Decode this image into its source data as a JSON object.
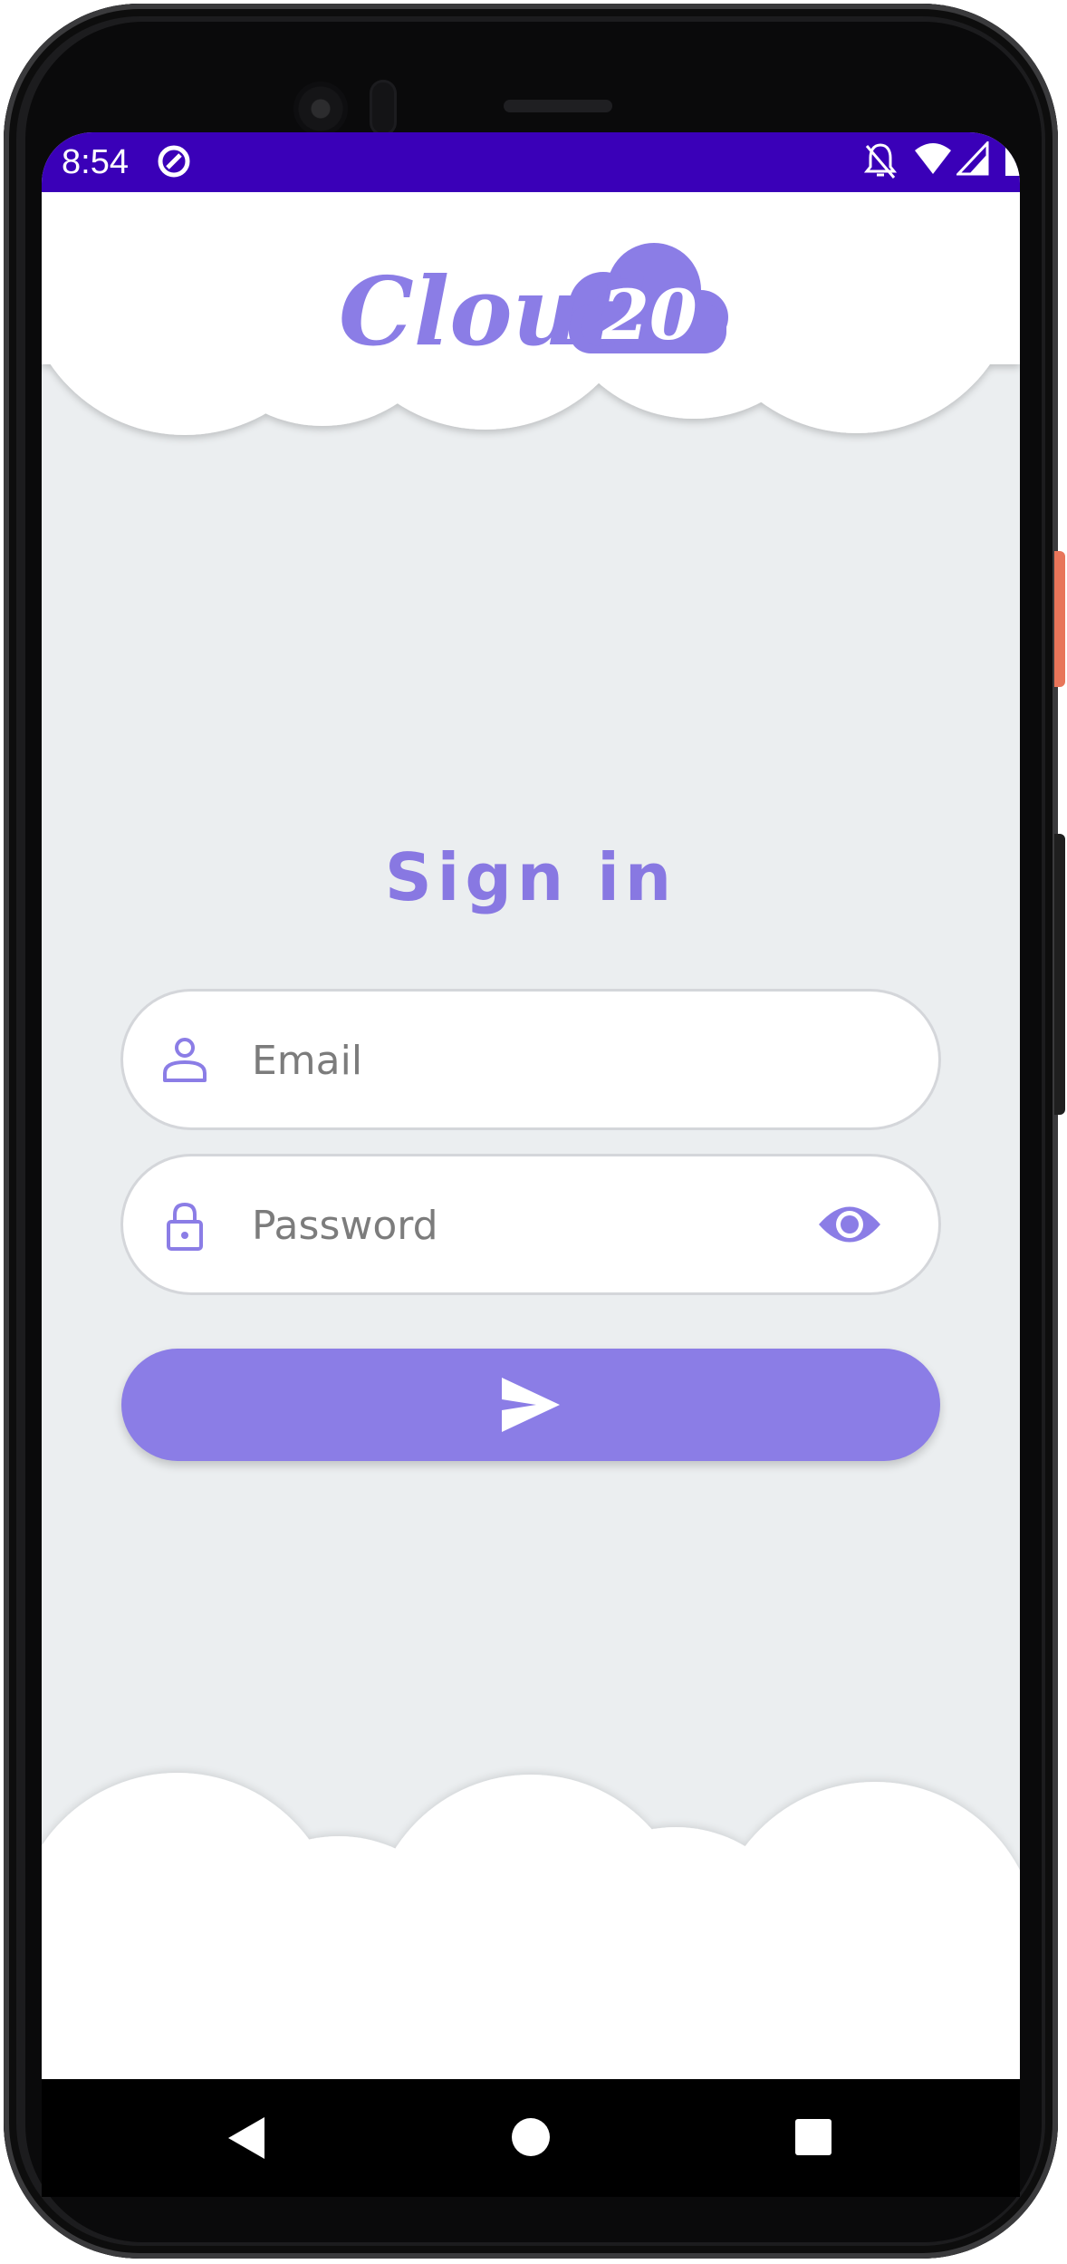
{
  "status_bar": {
    "time": "8:54",
    "icons": [
      "app-notification-icon",
      "bell-off-icon",
      "wifi-icon",
      "cell-signal-icon",
      "battery-icon"
    ]
  },
  "logo": {
    "text_word": "Cloud",
    "text_number": "20"
  },
  "login": {
    "title": "Sign in",
    "email_placeholder": "Email",
    "password_placeholder": "Password",
    "submit_icon": "send-icon"
  },
  "navigation": {
    "buttons": [
      "back",
      "home",
      "recents"
    ]
  },
  "colors": {
    "accent": "#8b7de6",
    "status_bar": "#3a00b8",
    "background": "#ebeef0",
    "cloud": "#ffffff"
  }
}
